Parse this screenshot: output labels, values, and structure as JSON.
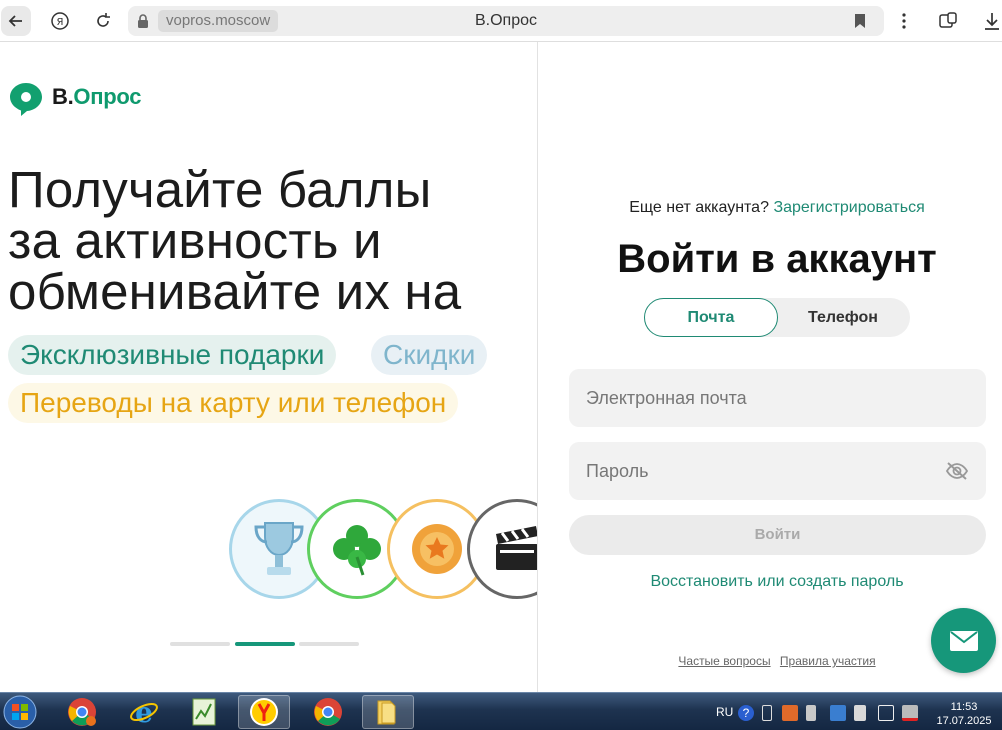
{
  "browser": {
    "domain": "vopros.moscow",
    "title": "В.Опрос"
  },
  "logo": {
    "part1": "В.",
    "part2": "Опрос"
  },
  "hero": {
    "headline_lines": [
      "Получайте баллы",
      "за активность и",
      "обменивайте их на"
    ],
    "chips": [
      "Эксклюзивные подарки",
      "Скидки",
      "Переводы на карту или телефон"
    ],
    "carousel_icons": [
      "trophy-icon",
      "clover-icon",
      "coin-star-icon",
      "clapperboard-icon"
    ],
    "carousel_active_index": 1,
    "carousel_count": 3
  },
  "login": {
    "no_account": "Еще нет аккаунта?",
    "register": "Зарегистрироваться",
    "title": "Войти в аккаунт",
    "tabs": [
      "Почта",
      "Телефон"
    ],
    "active_tab": "Почта",
    "email_placeholder": "Электронная почта",
    "password_placeholder": "Пароль",
    "submit": "Войти",
    "restore": "Восстановить или создать пароль",
    "footer_faq": "Частые вопросы",
    "footer_rules": "Правила участия"
  },
  "colors": {
    "brand": "#16977a",
    "accent_yellow": "#e6a514",
    "accent_blue": "#7fb5cc"
  },
  "taskbar": {
    "apps": [
      "chrome-icon",
      "ie-icon",
      "editor-icon",
      "yandex-icon",
      "chrome-icon",
      "folder-icon"
    ],
    "lang": "RU",
    "time": "11:53",
    "date": "17.07.2025"
  }
}
